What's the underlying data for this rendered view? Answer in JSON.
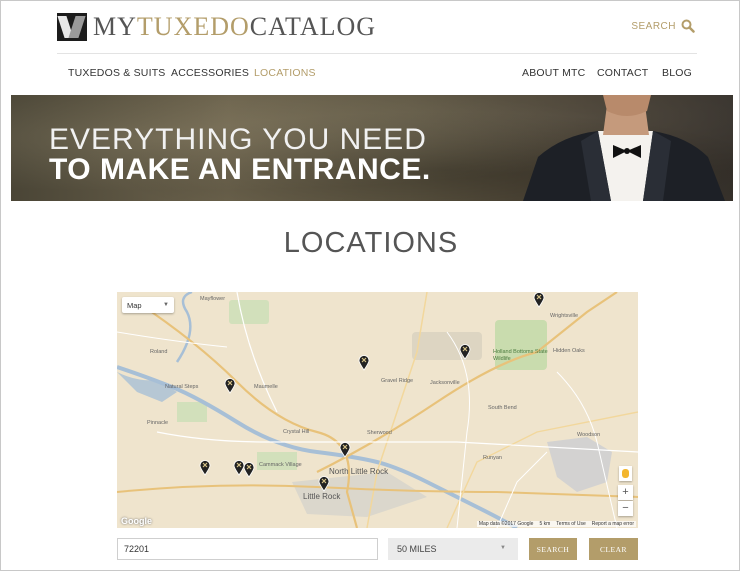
{
  "brand": {
    "prefix": "MY",
    "highlight": "TUXEDO",
    "suffix": "CATALOG",
    "gold": "#b39d6a"
  },
  "header": {
    "search_label": "SEARCH"
  },
  "nav_left": [
    "TUXEDOS & SUITS",
    "ACCESSORIES",
    "LOCATIONS"
  ],
  "nav_right": [
    "ABOUT MTC",
    "CONTACT",
    "BLOG"
  ],
  "active_nav": "LOCATIONS",
  "hero": {
    "line1": "EVERYTHING YOU NEED",
    "line2": "TO MAKE AN ENTRANCE."
  },
  "page_title": "LOCATIONS",
  "map": {
    "type_control": "Map",
    "zoom_in": "+",
    "zoom_out": "−",
    "logo": "Google",
    "attribution": [
      "Map data ©2017 Google",
      "5 km",
      "Terms of Use",
      "Report a map error"
    ],
    "places": [
      "Mayflower",
      "Roland",
      "Natural Steps",
      "Maumelle",
      "Pinnacle",
      "Crystal Hill",
      "Cammack Village",
      "North Little Rock",
      "Little Rock",
      "Sherwood",
      "Gravel Ridge",
      "Jacksonville",
      "Holland Bottoms State Wildlife",
      "South Bend",
      "Hidden Oaks",
      "Runyan",
      "Woodson",
      "Wrightsville"
    ],
    "store_pin_count": 10
  },
  "search_form": {
    "zip_value": "72201",
    "radius_value": "50 MILES",
    "search_button": "SEARCH",
    "clear_button": "CLEAR"
  }
}
